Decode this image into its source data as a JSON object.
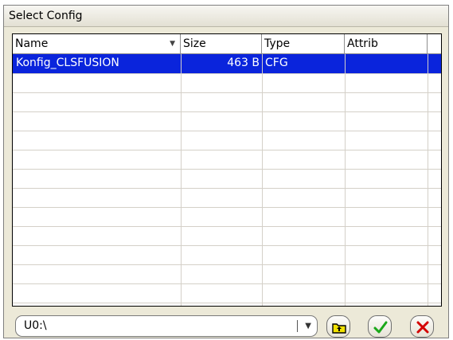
{
  "window": {
    "title": "Select Config"
  },
  "table": {
    "columns": [
      {
        "label": "Name",
        "sortable_icon": "sort-arrow-down-icon"
      },
      {
        "label": "Size"
      },
      {
        "label": "Type"
      },
      {
        "label": "Attrib"
      }
    ],
    "rows": [
      {
        "name": "Konfig_CLSFUSION",
        "size": "463 B",
        "type": "CFG",
        "attrib": "",
        "selected": true
      }
    ]
  },
  "drive_select": {
    "value": "U0:\\"
  },
  "buttons": {
    "up_folder": "folder-up-icon",
    "ok": "checkmark-icon",
    "cancel": "close-x-icon"
  },
  "colors": {
    "selection": "#0a24dc",
    "ok_green": "#1aa81a",
    "cancel_red": "#d40000",
    "folder_yellow": "#f2e200"
  }
}
